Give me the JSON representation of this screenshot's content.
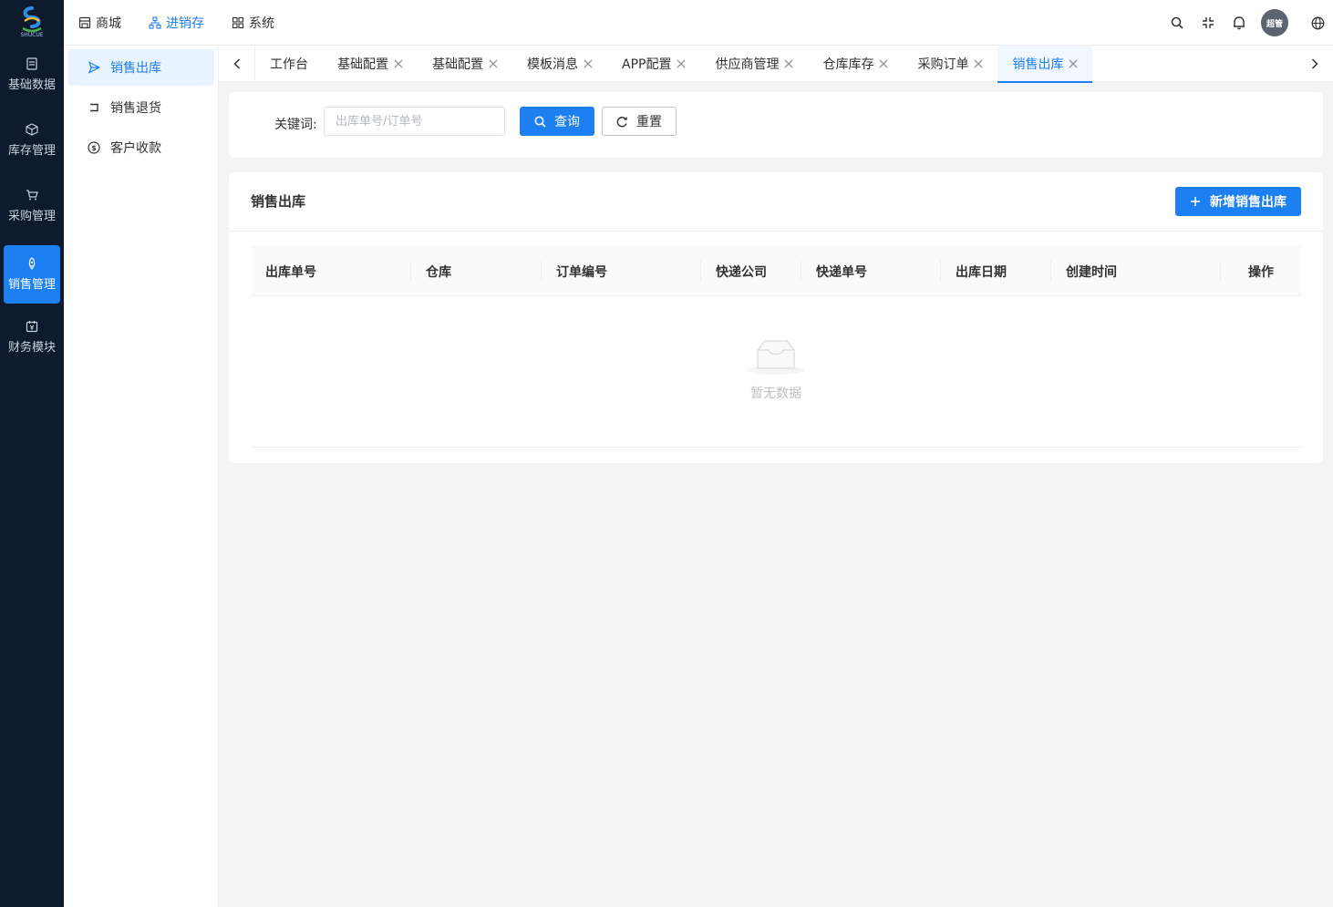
{
  "brand": {
    "logo_text": "SHUCUE"
  },
  "rail": {
    "items": [
      {
        "label": "基础数据",
        "icon": "document-icon",
        "active": false
      },
      {
        "label": "库存管理",
        "icon": "cube-icon",
        "active": false
      },
      {
        "label": "采购管理",
        "icon": "cart-icon",
        "active": false
      },
      {
        "label": "销售管理",
        "icon": "rocket-icon",
        "active": true
      },
      {
        "label": "财务模块",
        "icon": "finance-icon",
        "active": false
      }
    ]
  },
  "top_nav": {
    "items": [
      {
        "label": "商城",
        "icon": "store-icon",
        "active": false
      },
      {
        "label": "进销存",
        "icon": "sitemap-icon",
        "active": true
      },
      {
        "label": "系统",
        "icon": "grid-icon",
        "active": false
      }
    ]
  },
  "header_tools": {
    "icons": [
      "search-icon",
      "fullscreen-icon",
      "bell-icon"
    ],
    "avatar_text": "超管",
    "language_icon": "globe-icon"
  },
  "subside": {
    "items": [
      {
        "label": "销售出库",
        "icon": "send-icon",
        "active": true
      },
      {
        "label": "销售退货",
        "icon": "return-icon",
        "active": false
      },
      {
        "label": "客户收款",
        "icon": "dollar-icon",
        "active": false
      }
    ]
  },
  "tabs": {
    "items": [
      {
        "label": "工作台",
        "closable": false,
        "active": false
      },
      {
        "label": "基础配置",
        "closable": true,
        "active": false
      },
      {
        "label": "基础配置",
        "closable": true,
        "active": false
      },
      {
        "label": "模板消息",
        "closable": true,
        "active": false
      },
      {
        "label": "APP配置",
        "closable": true,
        "active": false
      },
      {
        "label": "供应商管理",
        "closable": true,
        "active": false
      },
      {
        "label": "仓库库存",
        "closable": true,
        "active": false
      },
      {
        "label": "采购订单",
        "closable": true,
        "active": false
      },
      {
        "label": "销售出库",
        "closable": true,
        "active": true
      }
    ]
  },
  "search": {
    "keyword_label": "关键词:",
    "keyword_placeholder": "出库单号/订单号",
    "keyword_value": "",
    "query_label": "查询",
    "reset_label": "重置"
  },
  "list": {
    "title": "销售出库",
    "add_label": "新增销售出库",
    "columns": [
      "出库单号",
      "仓库",
      "订单编号",
      "快递公司",
      "快递单号",
      "出库日期",
      "创建时间",
      "操作"
    ],
    "rows": [],
    "empty_text": "暂无数据"
  },
  "colors": {
    "primary": "#1c7ff2",
    "rail_bg": "#0e1a2e",
    "page_bg": "#f4f4f5"
  }
}
